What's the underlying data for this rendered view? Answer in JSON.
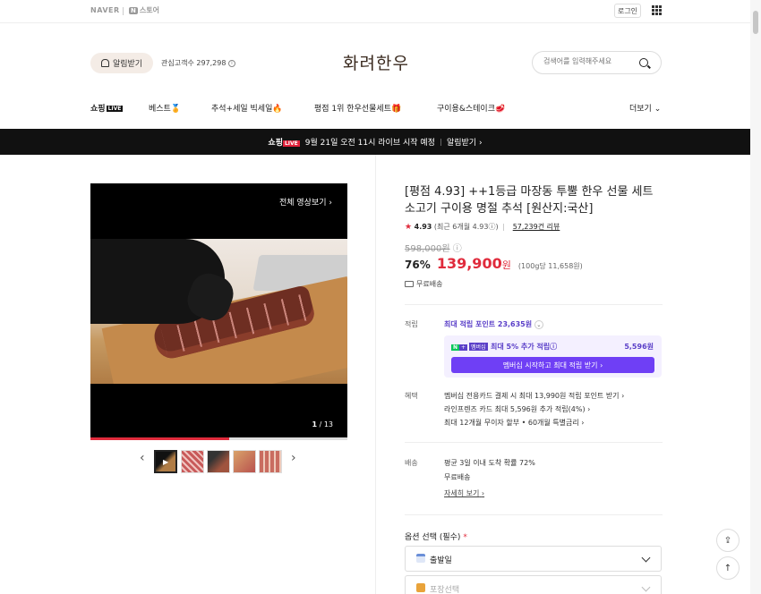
{
  "topbar": {
    "naver": "NAVER",
    "store_logo_n": "N",
    "store_logo": "스토어",
    "login": "로그인"
  },
  "header": {
    "bell_label": "알림받기",
    "fans_label": "관심고객수",
    "fans_count": "297,298",
    "store_name": "화려한우",
    "search_placeholder": "검색어를 입력해주세요"
  },
  "nav": {
    "shopping": "쇼핑",
    "live": "LIVE",
    "items": [
      "베스트🏅",
      "추석+세일 빅세일🔥",
      "평점 1위 한우선물세트🎁",
      "구이용&스테이크🥩"
    ],
    "more": "더보기"
  },
  "banner": {
    "shopping": "쇼핑",
    "live": "LIVE",
    "text": "9월 21일 오전 11시 라이브 시작 예정",
    "cta": "알림받기"
  },
  "media": {
    "full_video": "전체 영상보기",
    "counter_current": "1",
    "counter_total": "/ 13",
    "progress": 0.54
  },
  "product": {
    "title": "[평점 4.93] ++1등급 마장동 투뿔 한우 선물 세트 소고기 구이용 명절 추석 [원산지:국산]",
    "rating": "4.93",
    "rating_detail": "(최근 6개월 4.93",
    "reviews": "57,239건 리뷰",
    "original_price": "598,000원",
    "discount": "76%",
    "price": "139,900",
    "price_unit": "원",
    "per_100g": "(100g당 11,658원)",
    "free_shipping": "무료배송"
  },
  "points": {
    "label": "적립",
    "max_points": "최대 적립 포인트 23,635원",
    "np_n": "N",
    "np_plus": "+",
    "np_text": "멤버십",
    "bonus_text": "최대 5% 추가 적립",
    "bonus_amount": "5,596원",
    "member_button": "멤버십 시작하고 최대 적립 받기"
  },
  "benefits": {
    "label": "혜택",
    "lines": [
      "멤버십 전용카드 결제 시 최대 13,990원 적립 포인트 받기",
      "라인프렌즈 카드 최대 5,596원 추가 적립(4%)",
      "최대 12개월 무이자 할부 • 60개월 특별금리"
    ]
  },
  "delivery": {
    "label": "배송",
    "lines": [
      "평균 3일 이내 도착 확률 72%",
      "무료배송"
    ],
    "more": "자세히 보기"
  },
  "options": {
    "label": "옵션 선택 (필수)",
    "required": "*",
    "select1": "출발일",
    "select2": "포장선택"
  },
  "colors": {
    "accent_red": "#e02b3c",
    "member_purple": "#6f3ff5",
    "naver_green": "#03c75a"
  }
}
